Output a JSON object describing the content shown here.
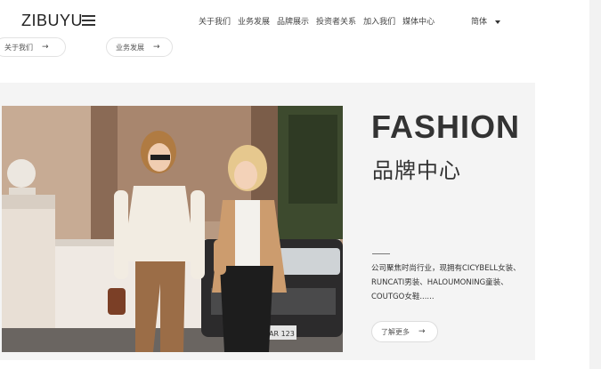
{
  "header": {
    "logo": "ZIBUYU",
    "nav": [
      "关于我们",
      "业务发展",
      "品牌展示",
      "投资者关系",
      "加入我们",
      "媒体中心"
    ],
    "language": "简体"
  },
  "quick_links": [
    {
      "label": "关于我们",
      "arrow": "→"
    },
    {
      "label": "业务发展",
      "arrow": "→"
    }
  ],
  "hero": {
    "title": "FASHION",
    "subtitle": "品牌中心",
    "description": "公司聚焦时尚行业，现拥有CICYBELL女装、RUNCATI男装、HALOUMONING童装、COUTGO女鞋......",
    "more_button": {
      "label": "了解更多",
      "arrow": "→"
    },
    "photo_plate": "AR 123"
  },
  "icons": [
    "menu-icon",
    "caret-down-icon",
    "arrow-right-icon"
  ]
}
